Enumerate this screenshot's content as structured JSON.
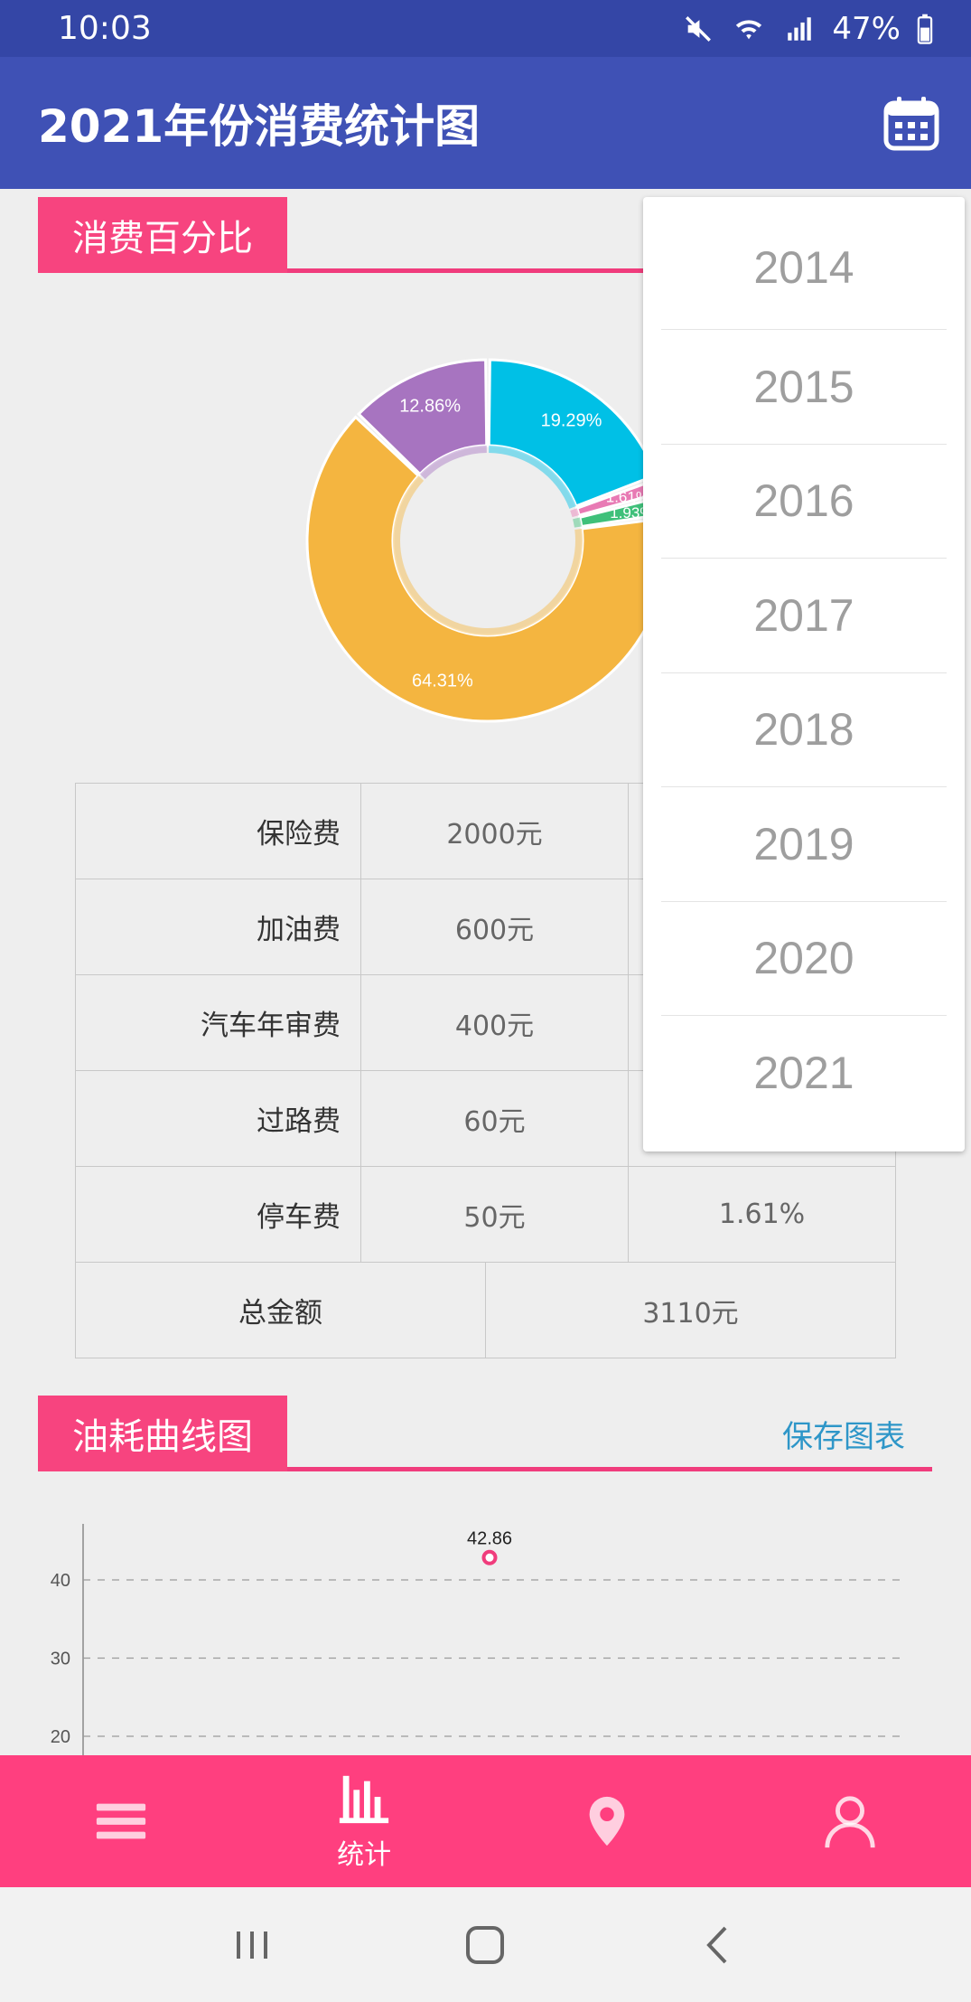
{
  "status_bar": {
    "time": "10:03",
    "battery": "47%",
    "icons": [
      "mute-icon",
      "wifi-icon",
      "signal-icon",
      "battery-icon"
    ]
  },
  "app_bar": {
    "title": "2021年份消费统计图",
    "action_icon": "calendar-icon"
  },
  "expense_section": {
    "title": "消费百分比"
  },
  "chart_data": [
    {
      "type": "pie",
      "style": "donut",
      "slices": [
        {
          "label": "保险费",
          "percent": 64.31,
          "display": "64.31%",
          "color": "#f4b540"
        },
        {
          "label": "加油费",
          "percent": 19.29,
          "display": "19.29%",
          "color": "#00c0e6"
        },
        {
          "label": "汽车年审费",
          "percent": 12.86,
          "display": "12.86%",
          "color": "#a774c0"
        },
        {
          "label": "过路费",
          "percent": 1.93,
          "display": "1.93%",
          "color": "#3fc07a"
        },
        {
          "label": "停车费",
          "percent": 1.61,
          "display": "1.61%",
          "color": "#e87ab4"
        }
      ]
    },
    {
      "type": "line",
      "title": "油耗曲线图",
      "y_ticks": [
        40,
        30,
        20
      ],
      "points": [
        {
          "value": 42.86,
          "label": "42.86"
        }
      ],
      "grid": "dashed"
    }
  ],
  "table": {
    "rows": [
      {
        "name": "保险费",
        "amount": "2000元",
        "percent": ""
      },
      {
        "name": "加油费",
        "amount": "600元",
        "percent": ""
      },
      {
        "name": "汽车年审费",
        "amount": "400元",
        "percent": ""
      },
      {
        "name": "过路费",
        "amount": "60元",
        "percent": ""
      },
      {
        "name": "停车费",
        "amount": "50元",
        "percent": "1.61%"
      }
    ],
    "total": {
      "label": "总金额",
      "amount": "3110元"
    }
  },
  "fuel_section": {
    "title": "油耗曲线图",
    "save_link": "保存图表"
  },
  "year_dropdown": {
    "years": [
      "2014",
      "2015",
      "2016",
      "2017",
      "2018",
      "2019",
      "2020",
      "2021"
    ]
  },
  "bottom_nav": {
    "items": [
      {
        "icon": "menu-icon",
        "label": ""
      },
      {
        "icon": "bar-chart-icon",
        "label": "统计"
      },
      {
        "icon": "location-pin-icon",
        "label": ""
      },
      {
        "icon": "user-icon",
        "label": ""
      }
    ],
    "active_index": 1
  },
  "system_nav": {
    "buttons": [
      "recent-apps-icon",
      "home-icon",
      "back-icon"
    ]
  },
  "colors": {
    "primary": "#3f51b5",
    "status_bar": "#3446a6",
    "accent_pink": "#ff3f7f",
    "link_blue": "#2e96c8"
  }
}
